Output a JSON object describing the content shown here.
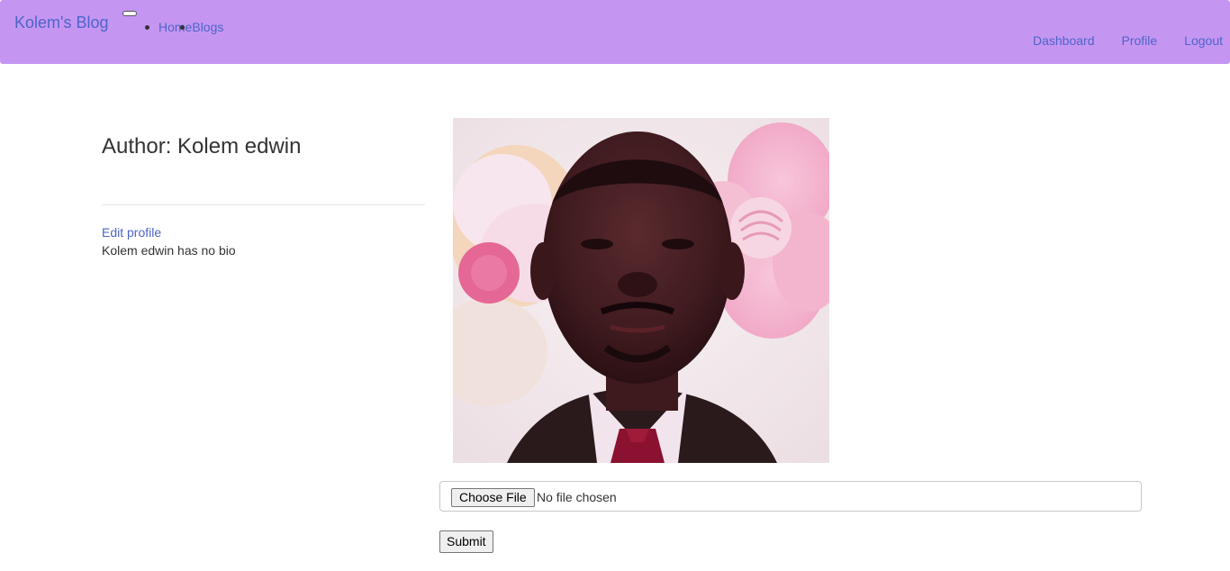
{
  "navbar": {
    "brand": "Kolem's Blog",
    "links": [
      {
        "label": "Home"
      },
      {
        "label": "Blogs"
      }
    ],
    "right_links": [
      {
        "label": "Dashboard"
      },
      {
        "label": "Profile"
      },
      {
        "label": "Logout"
      }
    ],
    "background_color": "#c496f2",
    "link_color": "#4e64c8"
  },
  "profile": {
    "title": "Author: Kolem edwin",
    "edit_link": "Edit profile",
    "bio": "Kolem edwin has no bio"
  },
  "upload": {
    "choose_label": "Choose File",
    "file_status": "No file chosen",
    "submit_label": "Submit"
  }
}
